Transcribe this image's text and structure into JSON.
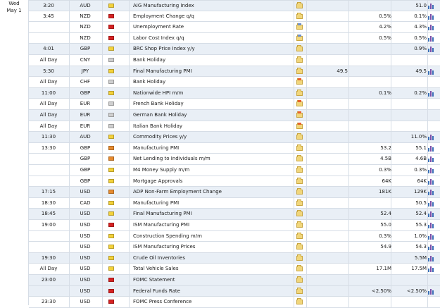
{
  "day": {
    "weekday": "Wed",
    "date": "May 1"
  },
  "impact_colors": {
    "high": "#d62222",
    "medium": "#e68a2e",
    "low": "#f3d13a",
    "none": "#cfcfcf"
  },
  "events": [
    {
      "time": "3:20",
      "currency": "AUD",
      "impact": "low",
      "event": "AIG Manufacturing Index",
      "icon": "folder-icon",
      "actual": "",
      "forecast": "",
      "previous": "51.0",
      "chart": true
    },
    {
      "time": "3:45",
      "currency": "NZD",
      "impact": "high",
      "event": "Employment Change q/q",
      "icon": "folder-icon",
      "actual": "",
      "forecast": "0.5%",
      "previous": "0.1%",
      "chart": true
    },
    {
      "time": "",
      "currency": "NZD",
      "impact": "high",
      "event": "Unemployment Rate",
      "icon": "folder-blue-icon",
      "actual": "",
      "forecast": "4.2%",
      "previous": "4.3%",
      "chart": true
    },
    {
      "time": "",
      "currency": "NZD",
      "impact": "high",
      "event": "Labor Cost Index q/q",
      "icon": "folder-blue-icon",
      "actual": "",
      "forecast": "0.5%",
      "previous": "0.5%",
      "chart": true
    },
    {
      "time": "4:01",
      "currency": "GBP",
      "impact": "low",
      "event": "BRC Shop Price Index y/y",
      "icon": "folder-icon",
      "actual": "",
      "forecast": "",
      "previous": "0.9%",
      "chart": true
    },
    {
      "time": "All Day",
      "currency": "CNY",
      "impact": "none",
      "event": "Bank Holiday",
      "icon": "folder-icon",
      "actual": "",
      "forecast": "",
      "previous": "",
      "chart": false
    },
    {
      "time": "5:30",
      "currency": "JPY",
      "impact": "low",
      "event": "Final Manufacturing PMI",
      "icon": "folder-icon",
      "actual": "49.5",
      "forecast": "",
      "previous": "49.5",
      "chart": true
    },
    {
      "time": "All Day",
      "currency": "CHF",
      "impact": "none",
      "event": "Bank Holiday",
      "icon": "folder-new-icon",
      "actual": "",
      "forecast": "",
      "previous": "",
      "chart": false
    },
    {
      "time": "11:00",
      "currency": "GBP",
      "impact": "low",
      "event": "Nationwide HPI m/m",
      "icon": "folder-icon",
      "actual": "",
      "forecast": "0.1%",
      "previous": "0.2%",
      "chart": true
    },
    {
      "time": "All Day",
      "currency": "EUR",
      "impact": "none",
      "event": "French Bank Holiday",
      "icon": "folder-new-icon",
      "actual": "",
      "forecast": "",
      "previous": "",
      "chart": false
    },
    {
      "time": "All Day",
      "currency": "EUR",
      "impact": "none",
      "event": "German Bank Holiday",
      "icon": "folder-new-icon",
      "actual": "",
      "forecast": "",
      "previous": "",
      "chart": false
    },
    {
      "time": "All Day",
      "currency": "EUR",
      "impact": "none",
      "event": "Italian Bank Holiday",
      "icon": "folder-new-icon",
      "actual": "",
      "forecast": "",
      "previous": "",
      "chart": false
    },
    {
      "time": "11:30",
      "currency": "AUD",
      "impact": "low",
      "event": "Commodity Prices y/y",
      "icon": "folder-icon",
      "actual": "",
      "forecast": "",
      "previous": "11.0%",
      "chart": true
    },
    {
      "time": "13:30",
      "currency": "GBP",
      "impact": "medium",
      "event": "Manufacturing PMI",
      "icon": "folder-icon",
      "actual": "",
      "forecast": "53.2",
      "previous": "55.1",
      "chart": true
    },
    {
      "time": "",
      "currency": "GBP",
      "impact": "medium",
      "event": "Net Lending to Individuals m/m",
      "icon": "folder-icon",
      "actual": "",
      "forecast": "4.5B",
      "previous": "4.6B",
      "chart": true
    },
    {
      "time": "",
      "currency": "GBP",
      "impact": "low",
      "event": "M4 Money Supply m/m",
      "icon": "folder-icon",
      "actual": "",
      "forecast": "0.3%",
      "previous": "0.3%",
      "chart": true
    },
    {
      "time": "",
      "currency": "GBP",
      "impact": "low",
      "event": "Mortgage Approvals",
      "icon": "folder-icon",
      "actual": "",
      "forecast": "64K",
      "previous": "64K",
      "chart": true
    },
    {
      "time": "17:15",
      "currency": "USD",
      "impact": "medium",
      "event": "ADP Non-Farm Employment Change",
      "icon": "folder-icon",
      "actual": "",
      "forecast": "181K",
      "previous": "129K",
      "chart": true
    },
    {
      "time": "18:30",
      "currency": "CAD",
      "impact": "low",
      "event": "Manufacturing PMI",
      "icon": "folder-icon",
      "actual": "",
      "forecast": "",
      "previous": "50.5",
      "chart": true
    },
    {
      "time": "18:45",
      "currency": "USD",
      "impact": "low",
      "event": "Final Manufacturing PMI",
      "icon": "folder-icon",
      "actual": "",
      "forecast": "52.4",
      "previous": "52.4",
      "chart": true
    },
    {
      "time": "19:00",
      "currency": "USD",
      "impact": "high",
      "event": "ISM Manufacturing PMI",
      "icon": "folder-icon",
      "actual": "",
      "forecast": "55.0",
      "previous": "55.3",
      "chart": true
    },
    {
      "time": "",
      "currency": "USD",
      "impact": "low",
      "event": "Construction Spending m/m",
      "icon": "folder-icon",
      "actual": "",
      "forecast": "0.3%",
      "previous": "1.0%",
      "chart": true
    },
    {
      "time": "",
      "currency": "USD",
      "impact": "low",
      "event": "ISM Manufacturing Prices",
      "icon": "folder-icon",
      "actual": "",
      "forecast": "54.9",
      "previous": "54.3",
      "chart": true
    },
    {
      "time": "19:30",
      "currency": "USD",
      "impact": "low",
      "event": "Crude Oil Inventories",
      "icon": "folder-icon",
      "actual": "",
      "forecast": "",
      "previous": "5.5M",
      "chart": true
    },
    {
      "time": "All Day",
      "currency": "USD",
      "impact": "low",
      "event": "Total Vehicle Sales",
      "icon": "folder-icon",
      "actual": "",
      "forecast": "17.1M",
      "previous": "17.5M",
      "chart": true
    },
    {
      "time": "23:00",
      "currency": "USD",
      "impact": "high",
      "event": "FOMC Statement",
      "icon": "folder-icon",
      "actual": "",
      "forecast": "",
      "previous": "",
      "chart": false
    },
    {
      "time": "",
      "currency": "USD",
      "impact": "high",
      "event": "Federal Funds Rate",
      "icon": "folder-icon",
      "actual": "",
      "forecast": "<2.50%",
      "previous": "<2.50%",
      "chart": true
    },
    {
      "time": "23:30",
      "currency": "USD",
      "impact": "high",
      "event": "FOMC Press Conference",
      "icon": "folder-icon",
      "actual": "",
      "forecast": "",
      "previous": "",
      "chart": false
    }
  ]
}
